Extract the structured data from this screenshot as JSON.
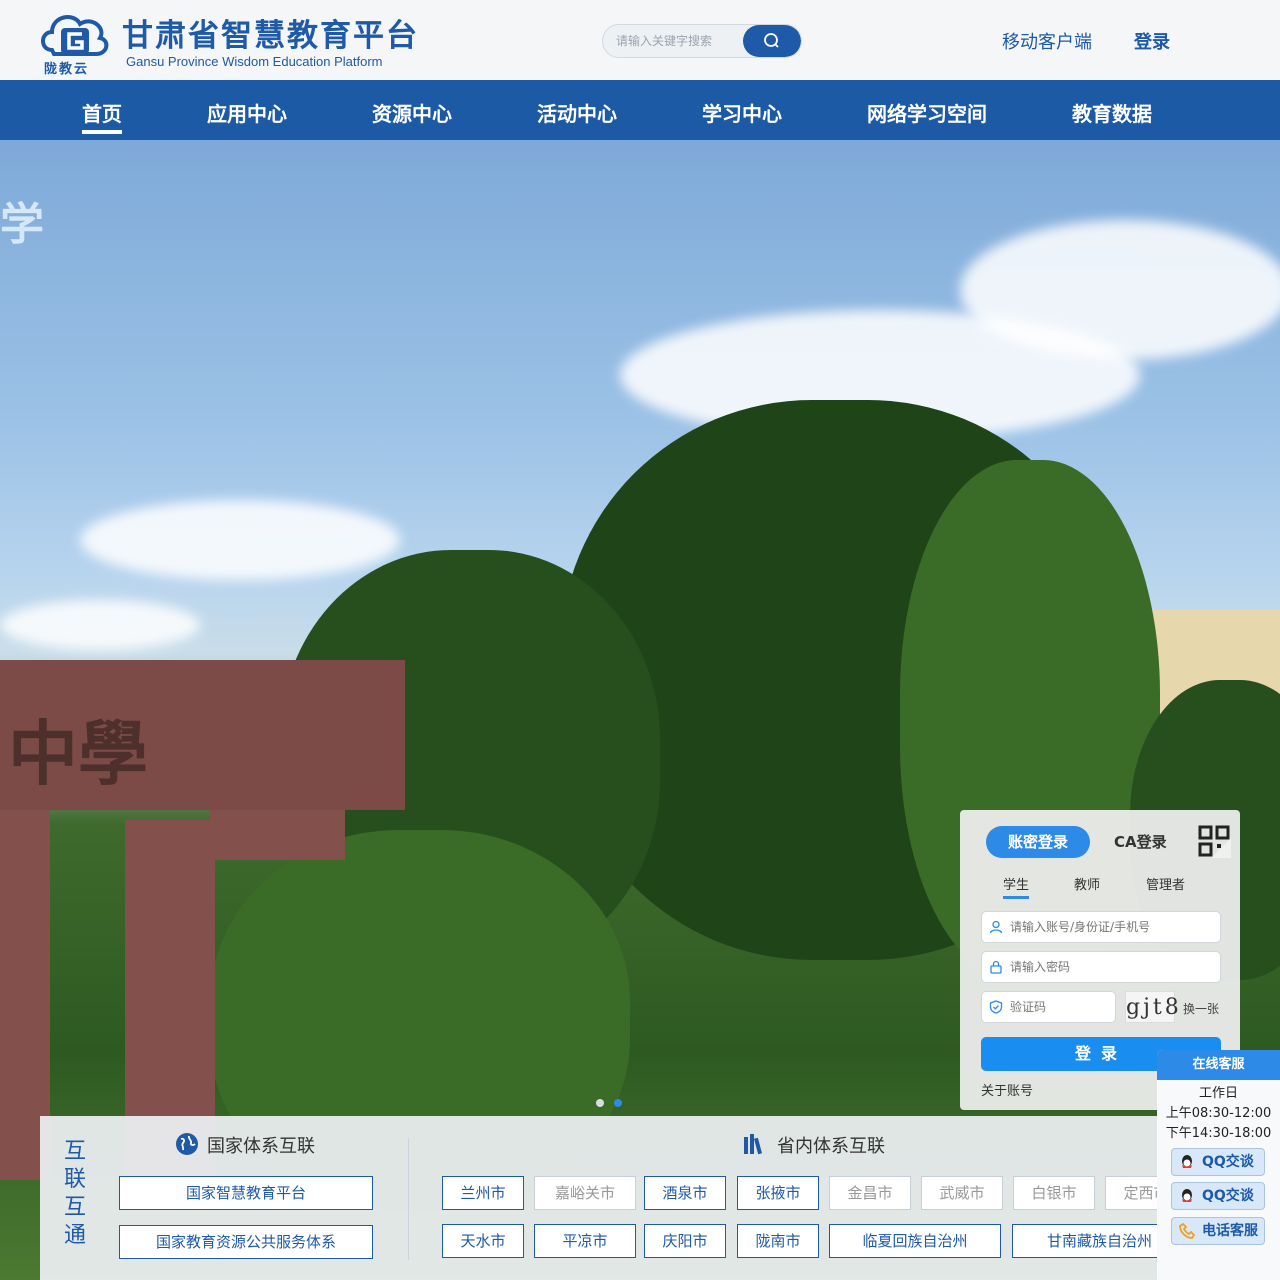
{
  "header": {
    "logo_text": "陇教云",
    "title": "甘肃省智慧教育平台",
    "subtitle": "Gansu Province Wisdom Education Platform",
    "search_placeholder": "请输入关键字搜索",
    "mobile_label": "移动客户端",
    "login_label": "登录"
  },
  "nav": {
    "items": [
      "首页",
      "应用中心",
      "资源中心",
      "活动中心",
      "学习中心",
      "网络学习空间",
      "教育数据"
    ],
    "active": "首页",
    "color": "#1d5aa6"
  },
  "banner": {
    "text": "学",
    "gate_text": "中學",
    "slides": 2,
    "active_slide": 2
  },
  "login": {
    "tab_password": "账密登录",
    "tab_ca": "CA登录",
    "roles": [
      "学生",
      "教师",
      "管理者"
    ],
    "active_role": "学生",
    "account_placeholder": "请输入账号/身份证/手机号",
    "password_placeholder": "请输入密码",
    "captcha_placeholder": "验证码",
    "captcha_text": "gjt8",
    "refresh_label": "换一张",
    "submit_label": "登录",
    "about_label": "关于账号",
    "accent": "#2d8ae6"
  },
  "interconnect": {
    "title": "互联互通",
    "national": {
      "title": "国家体系互联",
      "links": [
        "国家智慧教育平台",
        "国家教育资源公共服务体系"
      ]
    },
    "provincial": {
      "title": "省内体系互联",
      "row1": [
        "兰州市",
        "嘉峪关市",
        "酒泉市",
        "张掖市",
        "金昌市",
        "武威市",
        "白银市",
        "定西市"
      ],
      "row2": [
        "天水市",
        "平凉市",
        "庆阳市",
        "陇南市",
        "临夏回族自治州",
        "甘南藏族自治州"
      ]
    }
  },
  "service": {
    "title": "在线客服",
    "workday": "工作日",
    "morning": "上午08:30-12:00",
    "afternoon": "下午14:30-18:00",
    "qq1": "QQ交谈",
    "qq2": "QQ交谈",
    "phone": "电话客服"
  }
}
